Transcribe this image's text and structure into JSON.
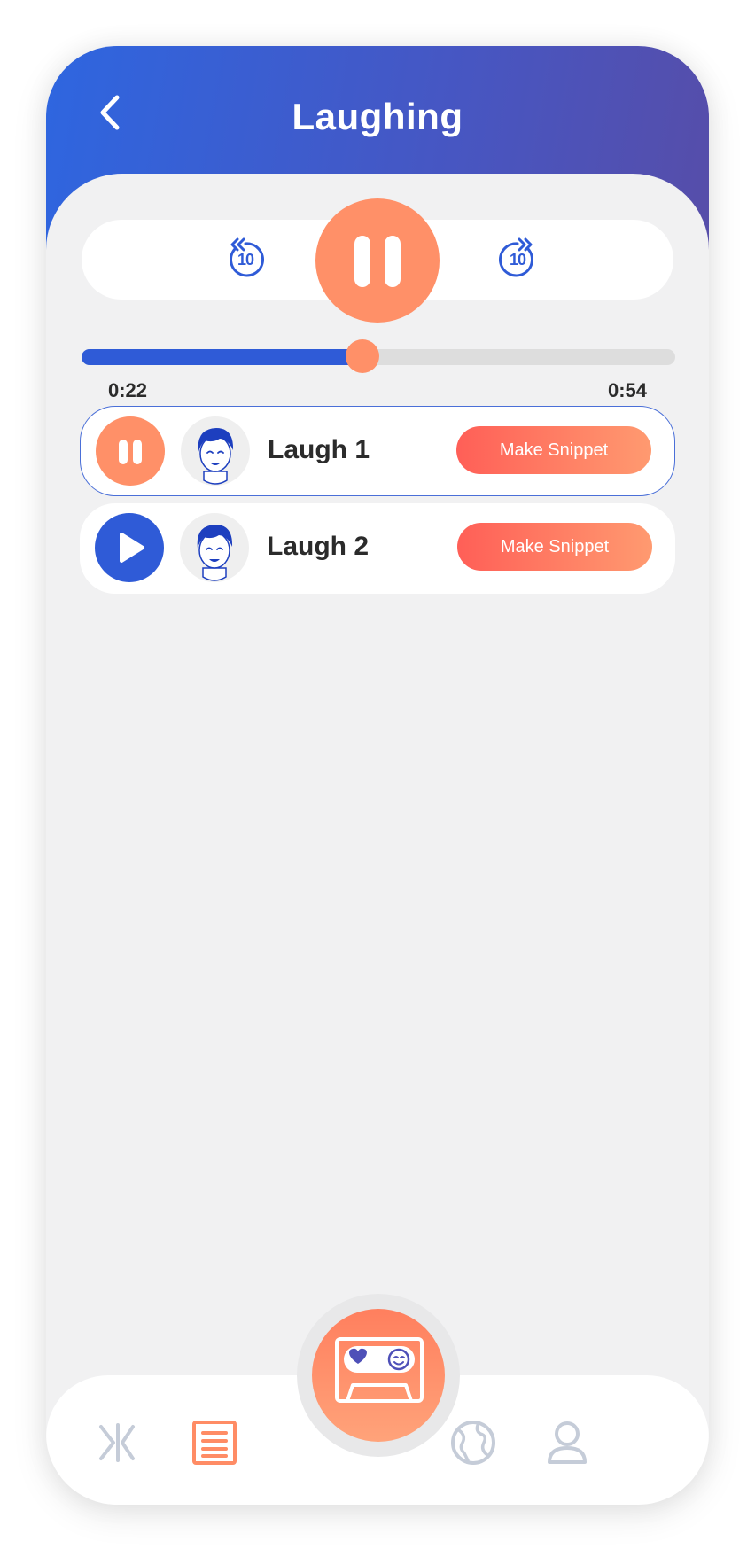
{
  "header": {
    "title": "Laughing"
  },
  "player": {
    "current_time": "0:22",
    "total_time": "0:54",
    "progress": 0.473,
    "skip_back_label": "10",
    "skip_forward_label": "10"
  },
  "tracks": [
    {
      "name": "Laugh 1",
      "state": "playing",
      "action_label": "Make Snippet"
    },
    {
      "name": "Laugh 2",
      "state": "paused",
      "action_label": "Make Snippet"
    }
  ],
  "colors": {
    "accent": "#ff9068",
    "primary": "#2f5bd7",
    "header_start": "#2e66e0",
    "header_end": "#574da8"
  },
  "tabbar": {
    "items": [
      "split-icon",
      "list-icon",
      "cassette-icon",
      "globe-icon",
      "profile-icon"
    ],
    "active": "list-icon"
  }
}
